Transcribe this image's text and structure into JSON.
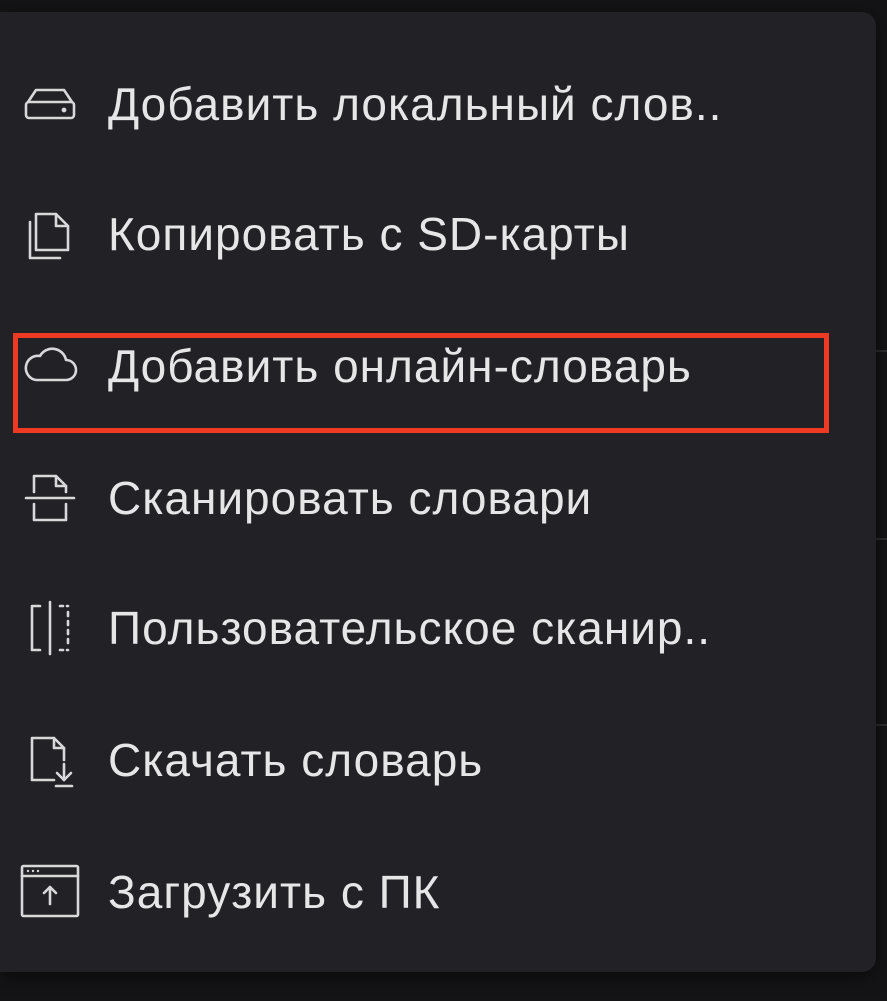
{
  "menu": {
    "items": [
      {
        "label": "Добавить локальный слов..",
        "icon": "drive-icon"
      },
      {
        "label": "Копировать с SD-карты",
        "icon": "copy-icon"
      },
      {
        "label": "Добавить онлайн-словарь",
        "icon": "cloud-icon"
      },
      {
        "label": "Сканировать словари",
        "icon": "scan-icon"
      },
      {
        "label": "Пользовательское сканир..",
        "icon": "custom-scan-icon"
      },
      {
        "label": "Скачать словарь",
        "icon": "file-download-icon"
      },
      {
        "label": "Загрузить с ПК",
        "icon": "upload-window-icon"
      }
    ]
  },
  "highlight": {
    "target": "Добавить онлайн-словарь",
    "color": "#ee3a22"
  },
  "colors": {
    "menu_background": "#222226",
    "text": "#e6e6e8",
    "page_background": "#141416"
  }
}
